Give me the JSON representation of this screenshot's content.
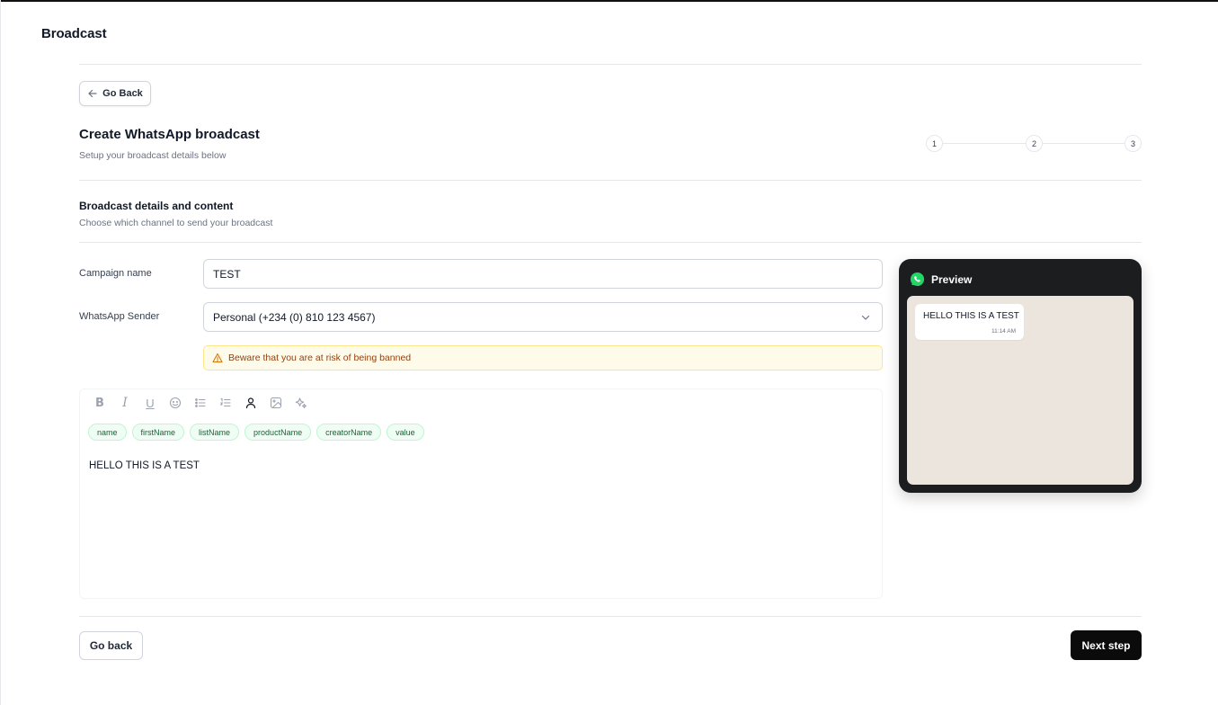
{
  "app": {
    "title": "Broadcast"
  },
  "nav": {
    "go_back_label": "Go Back"
  },
  "page": {
    "heading": "Create WhatsApp broadcast",
    "subheading": "Setup your broadcast details below"
  },
  "stepper": {
    "steps": [
      "1",
      "2",
      "3"
    ],
    "current_step": 1
  },
  "section": {
    "title": "Broadcast details and content",
    "subtitle": "Choose which channel to send your broadcast"
  },
  "form": {
    "campaign_label": "Campaign name",
    "campaign_value": "TEST",
    "sender_label": "WhatsApp Sender",
    "sender_value": "Personal (+234 (0) 810 123 4567)"
  },
  "warning": {
    "text": "Beware that you are at risk of being banned"
  },
  "editor": {
    "toolbar": [
      "bold-icon",
      "italic-icon",
      "underline-icon",
      "emoji-icon",
      "bullet-list-icon",
      "numbered-list-icon",
      "person-icon",
      "image-icon",
      "sparkle-icon"
    ],
    "tags": [
      "name",
      "firstName",
      "listName",
      "productName",
      "creatorName",
      "value"
    ],
    "content": "HELLO THIS IS A TEST"
  },
  "preview": {
    "title": "Preview",
    "message": "HELLO THIS IS A TEST",
    "time": "11:14 AM"
  },
  "footer": {
    "back_label": "Go back",
    "next_label": "Next step"
  },
  "colors": {
    "primary_button": "#0b0b0c",
    "whatsapp_green": "#25d366",
    "tag_bg": "#f0fdf4",
    "warning_bg": "#fffbeb",
    "chat_bg": "#ece5dd",
    "preview_frame": "#1c1d1f"
  }
}
